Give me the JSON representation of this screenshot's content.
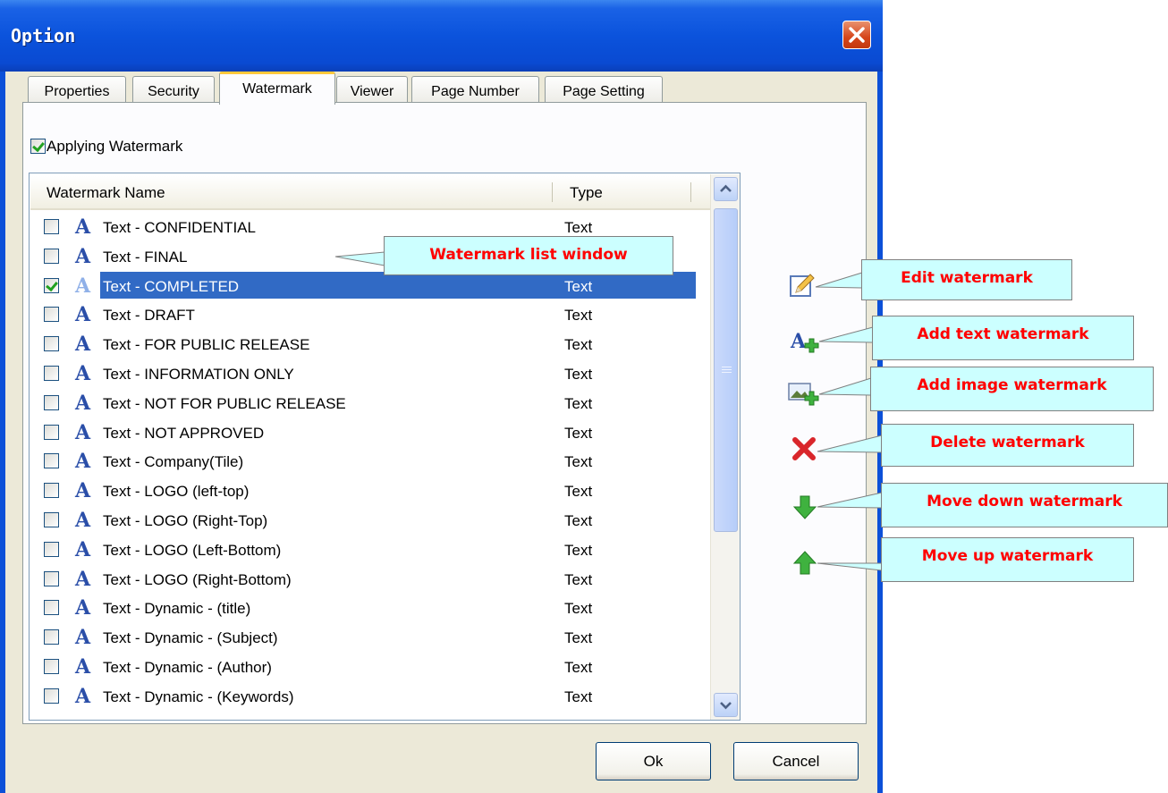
{
  "window": {
    "title": "Option"
  },
  "tabs": [
    "Properties",
    "Security",
    "Watermark",
    "Viewer",
    "Page Number",
    "Page Setting"
  ],
  "active_tab": "Watermark",
  "apply_label": "Applying Watermark",
  "apply_checked": true,
  "list": {
    "columns": {
      "name": "Watermark Name",
      "type": "Type"
    },
    "rows": [
      {
        "name": "Text - CONFIDENTIAL",
        "type": "Text",
        "checked": false
      },
      {
        "name": "Text - FINAL",
        "type": "Text",
        "checked": false
      },
      {
        "name": "Text - COMPLETED",
        "type": "Text",
        "checked": true,
        "selected": true
      },
      {
        "name": "Text - DRAFT",
        "type": "Text",
        "checked": false
      },
      {
        "name": "Text - FOR PUBLIC RELEASE",
        "type": "Text",
        "checked": false
      },
      {
        "name": "Text - INFORMATION ONLY",
        "type": "Text",
        "checked": false
      },
      {
        "name": "Text - NOT FOR PUBLIC RELEASE",
        "type": "Text",
        "checked": false
      },
      {
        "name": "Text - NOT APPROVED",
        "type": "Text",
        "checked": false
      },
      {
        "name": "Text - Company(Tile)",
        "type": "Text",
        "checked": false
      },
      {
        "name": "Text - LOGO (left-top)",
        "type": "Text",
        "checked": false
      },
      {
        "name": "Text - LOGO (Right-Top)",
        "type": "Text",
        "checked": false
      },
      {
        "name": "Text - LOGO (Left-Bottom)",
        "type": "Text",
        "checked": false
      },
      {
        "name": "Text - LOGO (Right-Bottom)",
        "type": "Text",
        "checked": false
      },
      {
        "name": "Text - Dynamic - (title)",
        "type": "Text",
        "checked": false
      },
      {
        "name": "Text - Dynamic - (Subject)",
        "type": "Text",
        "checked": false
      },
      {
        "name": "Text - Dynamic - (Author)",
        "type": "Text",
        "checked": false
      },
      {
        "name": "Text - Dynamic - (Keywords)",
        "type": "Text",
        "checked": false
      }
    ]
  },
  "tools": [
    "edit-icon",
    "add-text-icon",
    "add-image-icon",
    "delete-icon",
    "arrow-down-icon",
    "arrow-up-icon"
  ],
  "buttons": {
    "ok": "Ok",
    "cancel": "Cancel"
  },
  "callouts": {
    "list": "Watermark list window",
    "edit": "Edit watermark",
    "add_text": "Add text watermark",
    "add_image": "Add image watermark",
    "delete": "Delete watermark",
    "move_down": "Move down watermark",
    "move_up": "Move up watermark"
  },
  "colors": {
    "titlebar": "#0a4ad2",
    "selection": "#316ac5",
    "callout_bg": "#ccffff",
    "callout_text": "#ff0000"
  }
}
